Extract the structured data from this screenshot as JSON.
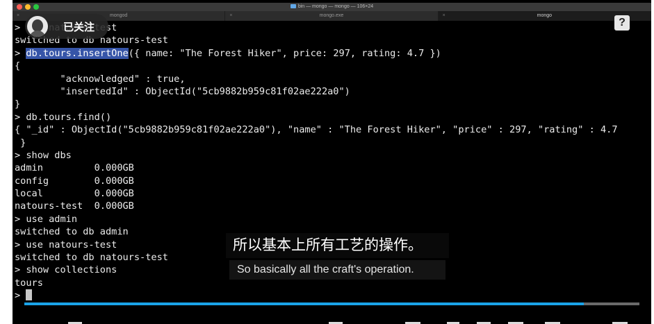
{
  "window": {
    "title": "bin — mongo — mongo — 106×24",
    "tabs": [
      "mongod",
      "mongo.exe",
      "mongo"
    ],
    "active_tab": 2
  },
  "channel": {
    "follow_label": "已关注"
  },
  "help": {
    "label": "?"
  },
  "terminal": {
    "lines": [
      "> use natours-test",
      "switched to db natours-test",
      "> db.tours.insertOne({ name: \"The Forest Hiker\", price: 297, rating: 4.7 })",
      "{",
      "        \"acknowledged\" : true,",
      "        \"insertedId\" : ObjectId(\"5cb9882b959c81f02ae222a0\")",
      "}",
      "> db.tours.find()",
      "{ \"_id\" : ObjectId(\"5cb9882b959c81f02ae222a0\"), \"name\" : \"The Forest Hiker\", \"price\" : 297, \"rating\" : 4.7",
      " }",
      "> show dbs",
      "admin         0.000GB",
      "config        0.000GB",
      "local         0.000GB",
      "natours-test  0.000GB",
      "> use admin",
      "switched to db admin",
      "> use natours-test",
      "switched to db natours-test",
      "> show collections",
      "tours",
      "> "
    ],
    "selection": {
      "prompt": "> ",
      "selected": "db.tours.insertOne",
      "rest": "({ name: \"The Forest Hiker\", price: 297, rating: 4.7 })"
    }
  },
  "subtitles": {
    "chinese": "所以基本上所有工艺的操作。",
    "english": "So basically all the craft's operation."
  },
  "player": {
    "progress": 0.91
  },
  "colors": {
    "selection": "#3655a8",
    "progress": "#1aa3e8",
    "terminal_bg": "#000000",
    "terminal_fg": "#ececec"
  }
}
